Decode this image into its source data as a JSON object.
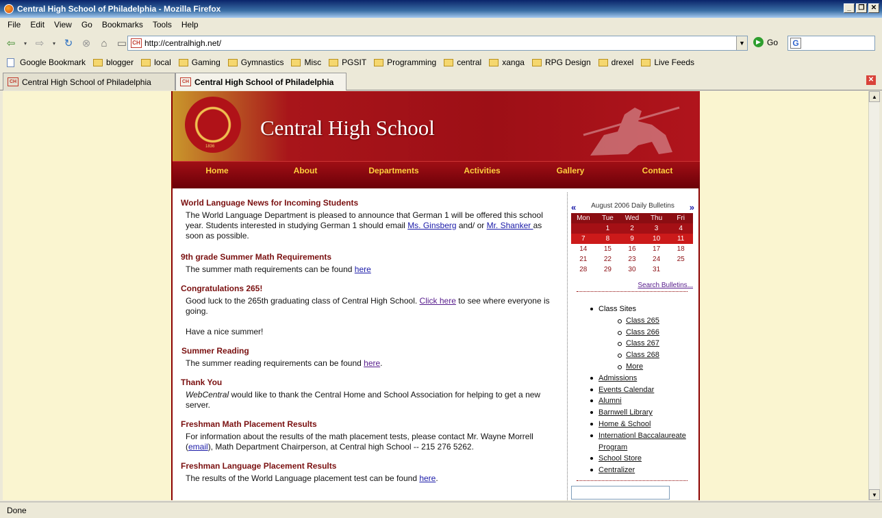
{
  "window": {
    "title": "Central High School of Philadelphia - Mozilla Firefox"
  },
  "menu": [
    "File",
    "Edit",
    "View",
    "Go",
    "Bookmarks",
    "Tools",
    "Help"
  ],
  "address": {
    "url": "http://centralhigh.net/",
    "go_label": "Go"
  },
  "bookmarks": [
    "Google Bookmark",
    "blogger",
    "local",
    "Gaming",
    "Gymnastics",
    "Misc",
    "PGSIT",
    "Programming",
    "central",
    "xanga",
    "RPG Design",
    "drexel",
    "Live Feeds"
  ],
  "tabs": [
    "Central High School of Philadelphia",
    "Central High School of Philadelphia"
  ],
  "status": "Done",
  "site": {
    "title": "Central High School",
    "seal_year": "1836",
    "nav": [
      "Home",
      "About",
      "Departments",
      "Activities",
      "Gallery",
      "Contact"
    ],
    "news": [
      {
        "head": "World Language News for Incoming Students",
        "body1": "The World Language Department is pleased to announce that German 1 will be offered this school year. Students interested in studying German 1 should email ",
        "link1": "Ms. Ginsberg",
        "mid": " and/ or ",
        "link2": "Mr. Shanker ",
        "tail": " as soon as possible."
      },
      {
        "head": "9th grade Summer Math Requirements",
        "body": "The summer math requirements can be found ",
        "link": "here"
      },
      {
        "head": "Congratulations 265!",
        "body": "Good luck to the 265th graduating class of Central High School.  ",
        "link": "Click here",
        "tail": " to see where everyone is going.",
        "extra": "Have a nice summer!"
      },
      {
        "head": "Summer Reading",
        "body": "The summer reading requirements can be found ",
        "link": "here",
        "tail": "."
      },
      {
        "head": "Thank You",
        "em": "WebCentral",
        "body": " would like to thank the Central Home and School Association for helping to get a new server."
      },
      {
        "head": "Freshman Math Placement Results",
        "body": "For information about the results of the math placement tests, please contact Mr. Wayne Morrell (",
        "link": "email",
        "tail": "), Math Department Chairperson, at Central high School -- 215 276 5262."
      },
      {
        "head": "Freshman Language Placement Results",
        "body": "The results of the World Language placement test can be found ",
        "link": "here",
        "tail": "."
      }
    ],
    "calendar": {
      "title": "August 2006 Daily Bulletins",
      "prev": "«",
      "next": "»",
      "days": [
        "Mon",
        "Tue",
        "Wed",
        "Thu",
        "Fri"
      ],
      "weeks": [
        [
          "",
          "1",
          "2",
          "3",
          "4"
        ],
        [
          "7",
          "8",
          "9",
          "10",
          "11"
        ],
        [
          "14",
          "15",
          "16",
          "17",
          "18"
        ],
        [
          "21",
          "22",
          "23",
          "24",
          "25"
        ],
        [
          "28",
          "29",
          "30",
          "31",
          ""
        ]
      ],
      "search": "Search Bulletins..."
    },
    "links": {
      "class_sites": "Class Sites",
      "classes": [
        "Class 265",
        "Class 266",
        "Class 267",
        "Class 268",
        "More"
      ],
      "items": [
        "Admissions",
        "Events Calendar",
        "Alumni",
        "Barnwell Library",
        "Home & School",
        "Internationl Baccalaureate Program",
        "School Store",
        "Centralizer"
      ]
    }
  }
}
